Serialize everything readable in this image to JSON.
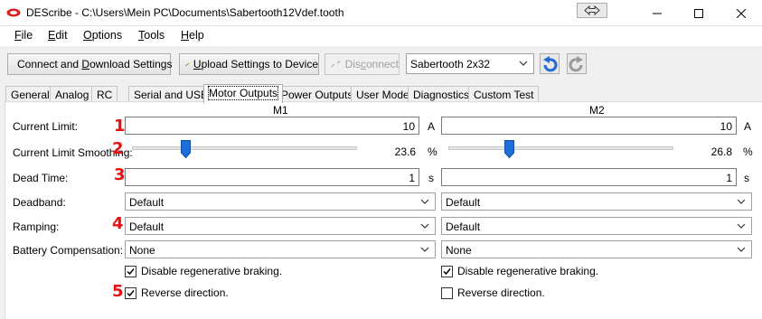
{
  "window": {
    "title": "DEScribe - C:\\Users\\Mein PC\\Documents\\Sabertooth12Vdef.tooth",
    "resize_icon": "double-arrow-icon"
  },
  "menu": [
    {
      "underline": "F",
      "rest": "ile"
    },
    {
      "underline": "E",
      "rest": "dit"
    },
    {
      "underline": "O",
      "rest": "ptions"
    },
    {
      "underline": "T",
      "rest": "ools"
    },
    {
      "underline": "H",
      "rest": "elp"
    }
  ],
  "toolbar": {
    "connect_pre": "Connect and ",
    "connect_ul": "D",
    "connect_post": "ownload Settings",
    "upload_ul": "U",
    "upload_post": "pload Settings to Device",
    "disconnect_pre": "Dis",
    "disconnect_ul": "c",
    "disconnect_post": "onnect",
    "device": "Sabertooth 2x32"
  },
  "tabs": [
    "General",
    "Analog",
    "RC",
    "Serial and USB",
    "Motor Outputs",
    "Power Outputs",
    "User Mode",
    "Diagnostics",
    "Custom Test"
  ],
  "active_tab": "Motor Outputs",
  "columns": {
    "m1": "M1",
    "m2": "M2"
  },
  "rows": {
    "current_limit": {
      "label": "Current Limit:",
      "marker": "1",
      "m1": "10",
      "m2": "10",
      "unit": "A"
    },
    "current_limit_smoothing": {
      "label": "Current Limit Smoothing:",
      "marker": "2",
      "m1": "23.6",
      "m2": "26.8",
      "unit": "%",
      "m1_level": 0.236,
      "m2_level": 0.268
    },
    "dead_time": {
      "label": "Dead Time:",
      "marker": "3",
      "m1": "1",
      "m2": "1",
      "unit": "s"
    },
    "deadband": {
      "label": "Deadband:",
      "m1": "Default",
      "m2": "Default"
    },
    "ramping": {
      "label": "Ramping:",
      "marker": "4",
      "m1": "Default",
      "m2": "Default"
    },
    "battery_compensation": {
      "label": "Battery Compensation:",
      "m1": "None",
      "m2": "None"
    }
  },
  "checks": {
    "regen_label": "Disable regenerative braking.",
    "reverse_label": "Reverse direction.",
    "marker": "5",
    "m1_regen": true,
    "m2_regen": true,
    "m1_reverse": true,
    "m2_reverse": false
  },
  "colors": {
    "marker": "#e81010",
    "slider_thumb": "#1e6fd9",
    "undo_icon": "#1f6cd6"
  }
}
